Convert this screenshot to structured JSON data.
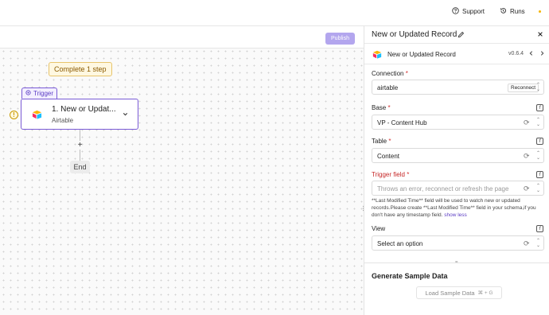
{
  "topbar": {
    "support_label": "Support",
    "runs_label": "Runs"
  },
  "canvas": {
    "publish_label": "Publish",
    "complete_step_label": "Complete 1 step",
    "trigger_tag_label": "Trigger",
    "step": {
      "title": "1. New or Updat...",
      "subtitle": "Airtable"
    },
    "end_label": "End"
  },
  "panel": {
    "title": "New or Updated Record",
    "step_name": "New or Updated Record",
    "version": "v0.6.4",
    "connection": {
      "label": "Connection",
      "value": "airtable",
      "reconnect_label": "Reconnect"
    },
    "base": {
      "label": "Base",
      "value": "VP - Content Hub"
    },
    "table": {
      "label": "Table",
      "value": "Content"
    },
    "trigger_field": {
      "label": "Trigger field",
      "placeholder": "Throws an error, reconnect or refresh the page",
      "description": "**Last Modified Time** field will be used to watch new or updated records.Please create **Last Modified Time** field in your schema,if you don't have any timestamp field.",
      "show_less": "show less"
    },
    "view": {
      "label": "View",
      "value": "Select an option"
    },
    "generate": {
      "title": "Generate Sample Data",
      "load_label": "Load Sample Data",
      "shortcut": "⌘ + G"
    }
  },
  "colors": {
    "accent": "#7a5bd6",
    "publish_bg": "#b3a6ee",
    "warning": "#c99a00",
    "error_label": "#c62828"
  }
}
